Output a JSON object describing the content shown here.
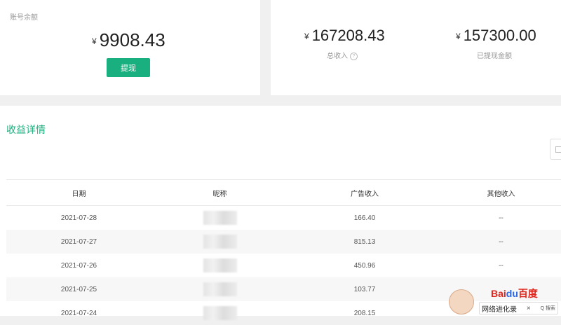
{
  "balance": {
    "label": "账号余额",
    "currency": "¥",
    "amount": "9908.43",
    "withdraw_label": "提现"
  },
  "income": {
    "currency": "¥",
    "total_amount": "167208.43",
    "total_label": "总收入",
    "withdrawn_amount": "157300.00",
    "withdrawn_label": "已提现金额"
  },
  "details": {
    "title": "收益详情",
    "columns": [
      "日期",
      "昵称",
      "广告收入",
      "其他收入"
    ],
    "rows": [
      {
        "date": "2021-07-28",
        "ad": "166.40",
        "other": "--"
      },
      {
        "date": "2021-07-27",
        "ad": "815.13",
        "other": "--"
      },
      {
        "date": "2021-07-26",
        "ad": "450.96",
        "other": "--"
      },
      {
        "date": "2021-07-25",
        "ad": "103.77",
        "other": ""
      },
      {
        "date": "2021-07-24",
        "ad": "208.15",
        "other": ""
      }
    ]
  },
  "watermark": {
    "brand_left": "Bai",
    "brand_mid": "du",
    "brand_right": "百度",
    "caption": "网络进化录",
    "search": "Q 搜索"
  },
  "colors": {
    "accent": "#1aaf7e"
  }
}
